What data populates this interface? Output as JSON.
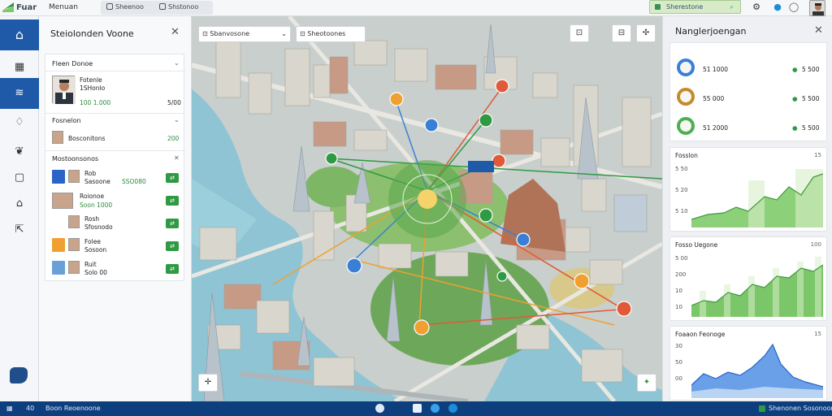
{
  "topbar": {
    "brand": "Fuar",
    "menu": "Menuan",
    "tabs": [
      {
        "label": "Sheenoo"
      },
      {
        "label": "Shstonoo"
      }
    ],
    "search_value": "Sherestone",
    "accent": "#2f9a43"
  },
  "leftnav": {
    "items": [
      "home-icon",
      "layout-icon",
      "waves-icon",
      "bell-icon",
      "leaf-icon",
      "file-icon",
      "building-icon",
      "car-icon"
    ],
    "active_color": "#1f5aa8"
  },
  "left_panel": {
    "title": "Steiolonden Voone",
    "section1": {
      "header": "Fleen Donoe",
      "person_name": "Fotenle",
      "person_sub": "1SHonlo",
      "person_value": "100 1.000",
      "person_extra": "5/00"
    },
    "section2": {
      "header": "Fosnelon",
      "item_label": "Bosconitons",
      "item_value": "200"
    },
    "section3": {
      "header": "Mostoonsonos",
      "rows": [
        {
          "name": "Rob",
          "sub": "Sasoone",
          "detail": "SSO080",
          "swatch": "#2a64c8"
        },
        {
          "name": "Roionoe",
          "sub": "Soon 1000",
          "detail": "",
          "swatch": ""
        },
        {
          "name": "Rosh",
          "sub": "Sfosnodo",
          "detail": "",
          "swatch": ""
        },
        {
          "name": "Folee",
          "sub": "Sosoon",
          "detail": "",
          "swatch": "#f0a030"
        },
        {
          "name": "Ruit",
          "sub": "Solo 00",
          "detail": "",
          "swatch": "#6aa0d8"
        }
      ]
    }
  },
  "map": {
    "filter1": "Sbanvosone",
    "filter2": "Sheotoones",
    "btn1": "⊡",
    "btn2": "⊟",
    "btn3": "✣",
    "colors": {
      "water": "#8fc4d4",
      "park": "#6da85a",
      "road": "#e9e7e1"
    }
  },
  "right_panel": {
    "title": "Nanglerjoengan",
    "rings": [
      {
        "color": "#3a7fd6",
        "label": "51 1000",
        "value": "5 500"
      },
      {
        "color": "#c58a2a",
        "label": "55 000",
        "value": "5 500"
      },
      {
        "color": "#4bb04f",
        "label": "51 2000",
        "value": "5 500"
      }
    ],
    "charts": [
      {
        "title": "Fosslon",
        "corner": "15",
        "ticks": [
          "5 50",
          "5 20",
          "5 10"
        ]
      },
      {
        "title": "Fosso Uegone",
        "corner": "100",
        "ticks": [
          "5 00",
          "200",
          "10",
          "10"
        ]
      },
      {
        "title": "Foaaon Feonoge",
        "corner": "15",
        "ticks": [
          "30",
          "50",
          "00"
        ]
      }
    ]
  },
  "statusbar": {
    "left": "Boon Reoenoone",
    "num": "40",
    "right": "Shenonen Sosonoon"
  }
}
